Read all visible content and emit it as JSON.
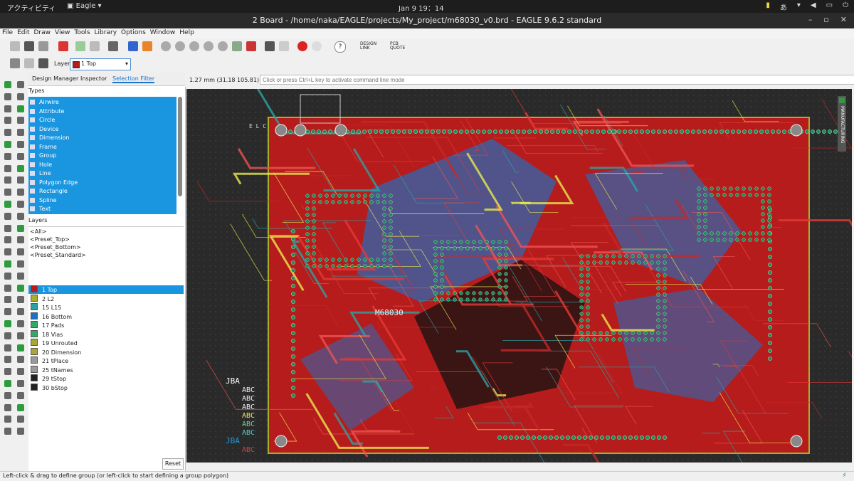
{
  "system": {
    "activities": "アクティビティ",
    "app_name": "Eagle",
    "clock": "Jan 9  19：14",
    "input_method": "あ"
  },
  "window": {
    "title": "2 Board - /home/naka/EAGLE/projects/My_project/m68030_v0.brd - EAGLE 9.6.2 standard"
  },
  "menu": [
    "File",
    "Edit",
    "Draw",
    "View",
    "Tools",
    "Library",
    "Options",
    "Window",
    "Help"
  ],
  "toolbar": {
    "design_link": "DESIGN LINK",
    "pcb_quote": "PCB QUOTE"
  },
  "layerbar": {
    "label": "Layer:",
    "selected": "1 Top",
    "selected_color": "#b71c1c"
  },
  "panel": {
    "tabs": [
      "Design Manager",
      "Inspector",
      "Selection Filter"
    ],
    "active_tab": "Selection Filter",
    "types_heading": "Types",
    "types": [
      "Airwire",
      "Attribute",
      "Circle",
      "Device",
      "Dimension",
      "Frame",
      "Group",
      "Hole",
      "Line",
      "Polygon Edge",
      "Rectangle",
      "Spline",
      "Text"
    ],
    "layers_heading": "Layers",
    "presets": [
      "<All>",
      "<Preset_Top>",
      "<Preset_Bottom>",
      "<Preset_Standard>"
    ],
    "layers": [
      {
        "name": "1 Top",
        "color": "#b71c1c"
      },
      {
        "name": "2 L2",
        "color": "#a8b028"
      },
      {
        "name": "15 L15",
        "color": "#2aa2a2"
      },
      {
        "name": "16 Bottom",
        "color": "#1a73c8"
      },
      {
        "name": "17 Pads",
        "color": "#34a868"
      },
      {
        "name": "18 Vias",
        "color": "#34a868"
      },
      {
        "name": "19 Unrouted",
        "color": "#a8a83a"
      },
      {
        "name": "20 Dimension",
        "color": "#a8a83a"
      },
      {
        "name": "21 tPlace",
        "color": "#9a9a9a"
      },
      {
        "name": "25 tNames",
        "color": "#9a9a9a"
      },
      {
        "name": "29 tStop",
        "color": "#222222"
      },
      {
        "name": "30 bStop",
        "color": "#222222"
      }
    ],
    "reset": "Reset"
  },
  "canvas": {
    "coord": "1.27 mm (31.18 105.81)",
    "command_placeholder": "Click or press Ctrl+L key to activate command line mode",
    "manufacturing": "MANUFACTURING",
    "board_label": "M68030",
    "elc": "E L C",
    "legend_title_1": "JBA",
    "legend_title_2": "JBA",
    "legend_abc": "ABC"
  },
  "status": {
    "text": "Left-click & drag to define group (or left-click to start defining a group polygon)"
  }
}
